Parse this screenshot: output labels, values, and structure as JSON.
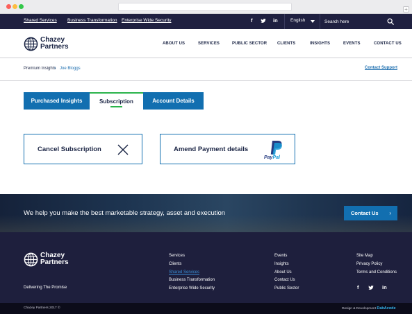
{
  "top_bar": {
    "links": [
      "Shared Services",
      "Business Transformation",
      "Enterprise Wide Security"
    ],
    "social": [
      "f",
      "t",
      "in"
    ],
    "language": "English",
    "search_placeholder": "Search here"
  },
  "header": {
    "logo_line1": "Chazey",
    "logo_line2": "Partners",
    "nav": [
      "ABOUT US",
      "SERVICES",
      "PUBLIC SECTOR",
      "CLIENTS",
      "INSIGHTS",
      "EVENTS",
      "CONTACT US"
    ]
  },
  "breadcrumb": {
    "items": [
      "Premium Insights",
      "Joe Bloggs"
    ],
    "separator": "›",
    "contact_support": "Contact Support"
  },
  "tabs": [
    {
      "label": "Purchased Insights",
      "active": false
    },
    {
      "label": "Subscription",
      "active": true
    },
    {
      "label": "Account Details",
      "active": false
    }
  ],
  "cards": {
    "cancel_label": "Cancel Subscription",
    "amend_label": "Amend Payment details",
    "paypal_text_a": "Pay",
    "paypal_text_b": "Pal"
  },
  "cta": {
    "text": "We help you make the best marketable strategy, asset and execution",
    "button": "Contact Us",
    "chevron": "›"
  },
  "footer": {
    "logo_line1": "Chazey",
    "logo_line2": "Partners",
    "tagline": "Delivering The Promise",
    "col1": [
      "Services",
      "Clients",
      "Shared Services",
      "Business Transformation",
      "Enterprise Wide Security"
    ],
    "col2": [
      "Events",
      "Insights",
      "About Us",
      "Contact Us",
      "Public Sector"
    ],
    "col3": [
      "Site Map",
      "Privacy Policy",
      "Terms and Conditions"
    ],
    "social": [
      "f",
      "t",
      "in"
    ]
  },
  "bottom_bar": {
    "copyright": "Chazey Partners 2017 ©",
    "credit_prefix": "Design & Development",
    "credit_brand": "DabAcode"
  },
  "colors": {
    "navy": "#1f2040",
    "accent_blue": "#126fb0",
    "active_green": "#2ab34a"
  }
}
